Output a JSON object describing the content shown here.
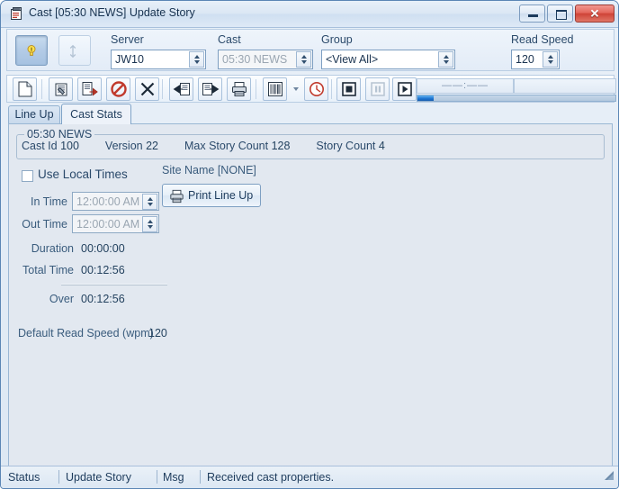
{
  "window": {
    "title": "Cast [05:30 NEWS] Update Story",
    "icon": "notepad-icon",
    "minimize_label": "",
    "maximize_label": "",
    "close_label": "✕"
  },
  "topform": {
    "bulb_button": "lightbulb-toggle",
    "arrow_button": "vertical-arrow",
    "fields": [
      {
        "label": "Server",
        "value": "JW10",
        "disabled": false
      },
      {
        "label": "Cast",
        "value": "05:30 NEWS",
        "disabled": true
      },
      {
        "label": "Group",
        "value": "<View All>",
        "disabled": false
      }
    ],
    "read_speed": {
      "label": "Read Speed",
      "value": "120"
    }
  },
  "toolbar": {
    "buttons": [
      "new-document-icon",
      "edit-script-icon",
      "approve-story-icon",
      "reject-story-icon",
      "delete-icon",
      "move-in-icon",
      "move-out-icon",
      "print-icon",
      "script-view-icon",
      "dropdown-caret-icon",
      "clock-icon",
      "stop-icon",
      "pause-icon",
      "play-icon"
    ],
    "time_display": "——:——",
    "progress_percent": 8
  },
  "tabs": [
    {
      "label": "Line Up",
      "active": false
    },
    {
      "label": "Cast Stats",
      "active": true
    }
  ],
  "cast_stats": {
    "group_title": "05:30 NEWS",
    "stats": [
      {
        "label": "Cast Id",
        "value": "100"
      },
      {
        "label": "Version",
        "value": "22"
      },
      {
        "label": "Max Story Count",
        "value": "128"
      },
      {
        "label": "Story Count",
        "value": "4"
      }
    ],
    "use_local_times": {
      "label": "Use Local Times",
      "checked": false
    },
    "site_name": "Site Name [NONE]",
    "print_button": "Print Line Up",
    "in_time": {
      "label": "In Time",
      "value": "12:00:00 AM"
    },
    "out_time": {
      "label": "Out Time",
      "value": "12:00:00 AM"
    },
    "duration": {
      "label": "Duration",
      "value": "00:00:00"
    },
    "total_time": {
      "label": "Total Time",
      "value": "00:12:56"
    },
    "over": {
      "label": "Over",
      "value": "00:12:56"
    },
    "default_read_speed": {
      "label": "Default Read Speed (wpm)",
      "value": "120"
    }
  },
  "statusbar": {
    "status_label": "Status",
    "status_value": "Update Story",
    "msg_label": "Msg",
    "msg_value": "Received cast properties."
  },
  "colors": {
    "accent": "#1a72d0",
    "panel": "#e2e8f0",
    "chrome": "#dce7f3",
    "text": "#1d3b5c",
    "close_red": "#cf4437",
    "bulb_yellow": "#ffe34d"
  }
}
